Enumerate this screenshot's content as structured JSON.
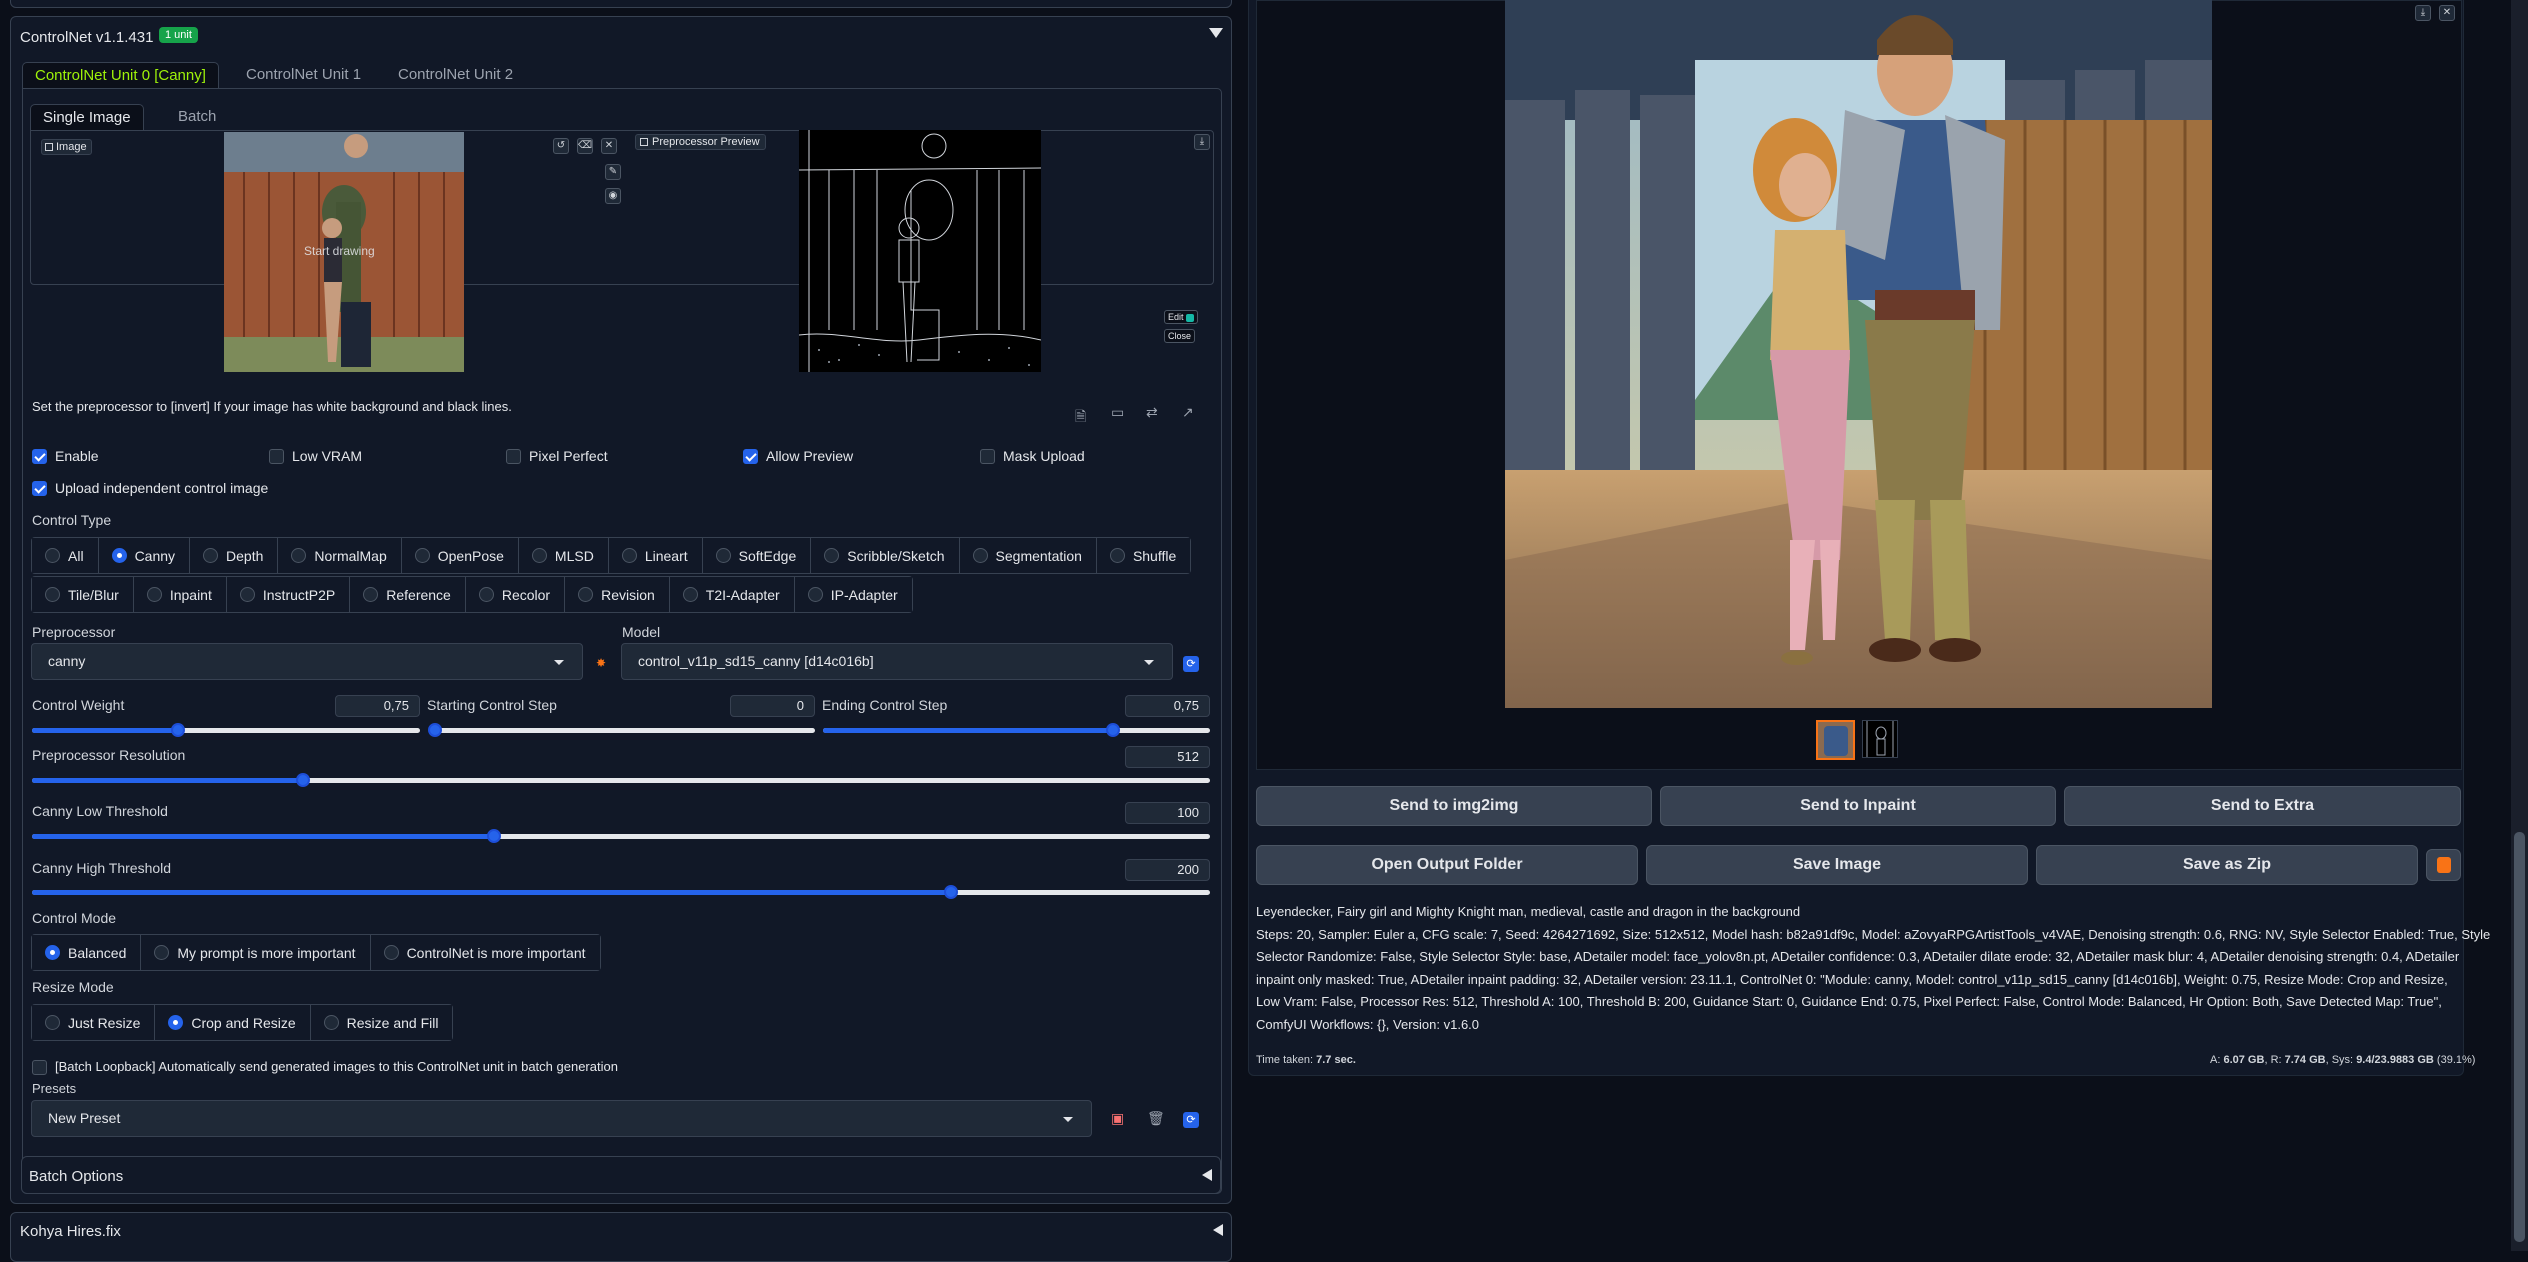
{
  "controlnet": {
    "title": "ControlNet v1.1.431",
    "badge": "1 unit",
    "unit_tabs": [
      "ControlNet Unit 0 [Canny]",
      "ControlNet Unit 1",
      "ControlNet Unit 2"
    ],
    "image_tabs": [
      "Single Image",
      "Batch"
    ],
    "image_label": "Image",
    "start_drawing": "Start drawing",
    "preview_label": "Preprocessor Preview",
    "edit_label": "Edit",
    "close_label": "Close",
    "hint": "Set the preprocessor to [invert] If your image has white background and black lines.",
    "checkboxes": {
      "enable": "Enable",
      "low_vram": "Low VRAM",
      "pixel_perfect": "Pixel Perfect",
      "allow_preview": "Allow Preview",
      "mask_upload": "Mask Upload",
      "upload_independent": "Upload independent control image"
    },
    "control_type_label": "Control Type",
    "control_types_row1": [
      "All",
      "Canny",
      "Depth",
      "NormalMap",
      "OpenPose",
      "MLSD",
      "Lineart",
      "SoftEdge",
      "Scribble/Sketch",
      "Segmentation",
      "Shuffle"
    ],
    "control_types_row2": [
      "Tile/Blur",
      "Inpaint",
      "InstructP2P",
      "Reference",
      "Recolor",
      "Revision",
      "T2I-Adapter",
      "IP-Adapter"
    ],
    "control_type_selected": "Canny",
    "preprocessor_label": "Preprocessor",
    "preprocessor_value": "canny",
    "model_label": "Model",
    "model_value": "control_v11p_sd15_canny [d14c016b]",
    "control_weight_label": "Control Weight",
    "control_weight_value": "0,75",
    "control_weight_frac": 0.375,
    "starting_step_label": "Starting Control Step",
    "starting_step_value": "0",
    "starting_step_frac": 0.0,
    "ending_step_label": "Ending Control Step",
    "ending_step_value": "0,75",
    "ending_step_frac": 0.75,
    "preproc_res_label": "Preprocessor Resolution",
    "preproc_res_value": "512",
    "preproc_res_frac": 0.23,
    "canny_low_label": "Canny Low Threshold",
    "canny_low_value": "100",
    "canny_low_frac": 0.392,
    "canny_high_label": "Canny High Threshold",
    "canny_high_value": "200",
    "canny_high_frac": 0.78,
    "control_mode_label": "Control Mode",
    "control_modes": [
      "Balanced",
      "My prompt is more important",
      "ControlNet is more important"
    ],
    "resize_mode_label": "Resize Mode",
    "resize_modes": [
      "Just Resize",
      "Crop and Resize",
      "Resize and Fill"
    ],
    "batch_loopback": "[Batch Loopback] Automatically send generated images to this ControlNet unit in batch generation",
    "presets_label": "Presets",
    "presets_value": "New Preset"
  },
  "accordions": {
    "batch_options": "Batch Options",
    "kohya": "Kohya Hires.fix"
  },
  "output": {
    "send_img2img": "Send to img2img",
    "send_inpaint": "Send to Inpaint",
    "send_extra": "Send to Extra",
    "open_folder": "Open Output Folder",
    "save_image": "Save Image",
    "save_zip": "Save as Zip",
    "prompt": "Leyendecker, Fairy girl and Mighty Knight man, medieval, castle and dragon in the background",
    "params": [
      "Steps: 20, Sampler: Euler a, CFG scale: 7, Seed: 4264271692, Size: 512x512, Model hash: b82a91df9c, Model: aZovyaRPGArtistTools_v4VAE, Denoising strength: 0.6, RNG: NV, Style Selector Enabled: True, Style",
      "Selector Randomize: False, Style Selector Style: base, ADetailer model: face_yolov8n.pt, ADetailer confidence: 0.3, ADetailer dilate erode: 32, ADetailer mask blur: 4, ADetailer denoising strength: 0.4, ADetailer",
      "inpaint only masked: True, ADetailer inpaint padding: 32, ADetailer version: 23.11.1, ControlNet 0: \"Module: canny, Model: control_v11p_sd15_canny [d14c016b], Weight: 0.75, Resize Mode: Crop and Resize,",
      "Low Vram: False, Processor Res: 512, Threshold A: 100, Threshold B: 200, Guidance Start: 0, Guidance End: 0.75, Pixel Perfect: False, Control Mode: Balanced, Hr Option: Both, Save Detected Map: True\",",
      "ComfyUI Workflows: {}, Version: v1.6.0"
    ],
    "time_label": "Time taken:",
    "time_value": "7.7 sec.",
    "vram_a_label": "A:",
    "vram_a": "6.07 GB",
    "vram_r_label": "R:",
    "vram_r": "7.74 GB",
    "vram_sys_label": "Sys:",
    "vram_sys": "9.4/23.9883 GB",
    "vram_pct": "(39.1%)"
  },
  "colors": {
    "accent": "#2563eb",
    "tab_active": "#9ef20a",
    "badge": "#16a34a"
  }
}
